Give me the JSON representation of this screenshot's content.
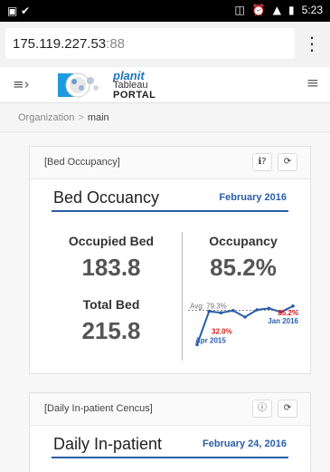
{
  "status_bar": {
    "time": "5:23"
  },
  "browser": {
    "url_host": "175.119.227.53",
    "url_port": ":88"
  },
  "app": {
    "logo": {
      "line1": "planit",
      "line2": "Tableau",
      "line3": "PORTAL"
    }
  },
  "breadcrumb": {
    "root": "Organization",
    "separator": ">",
    "current": "main"
  },
  "panels": [
    {
      "header": "[Bed Occupancy]",
      "tools": [
        "info-icon",
        "refresh-icon"
      ],
      "viz": {
        "title": "Bed Occuancy",
        "date": "February 2016",
        "kpis": [
          {
            "label": "Occupied Bed",
            "value": "183.8"
          },
          {
            "label": "Total Bed",
            "value": "215.8"
          },
          {
            "label": "Occupancy",
            "value": "85.2%"
          }
        ],
        "chart_data": {
          "type": "line",
          "series": [
            {
              "values": [
                32.0,
                78.0,
                76.0,
                79.0,
                70.0,
                80.0,
                82.0,
                77.0,
                85.2
              ]
            }
          ],
          "average_label": "Avg: 79.3%",
          "annotations": [
            {
              "value": "32.0%",
              "label": "Apr 2015"
            },
            {
              "value": "85.2%",
              "label": "Jan 2016"
            }
          ],
          "colors": {
            "line": "#2a5ea8",
            "annotation_value": "#cc2222",
            "average": "#888888"
          }
        }
      }
    },
    {
      "header": "[Daily In-patient Cencus]",
      "tools": [
        "info-icon",
        "refresh-icon"
      ],
      "viz": {
        "title": "Daily In-patient",
        "date": "February 24, 2016"
      }
    }
  ]
}
